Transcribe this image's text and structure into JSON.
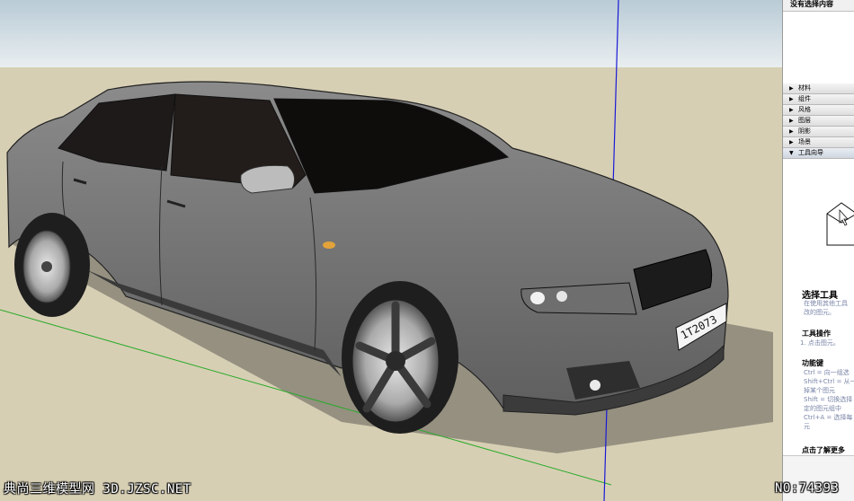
{
  "panel": {
    "title": "没有选择内容",
    "trays": [
      {
        "label": "材料",
        "state": "collapsed"
      },
      {
        "label": "组件",
        "state": "collapsed"
      },
      {
        "label": "风格",
        "state": "collapsed"
      },
      {
        "label": "图层",
        "state": "collapsed"
      },
      {
        "label": "阴影",
        "state": "collapsed"
      },
      {
        "label": "场景",
        "state": "collapsed"
      },
      {
        "label": "工具向导",
        "state": "expanded"
      }
    ]
  },
  "instructor": {
    "heading": "选择工具",
    "desc1": "在使用其他工具",
    "desc2": "改的图元。",
    "ops_title": "工具操作",
    "ops_line": "1.  点击图元。",
    "keys_title": "功能键",
    "keys_lines": [
      "Ctrl = 向一组选",
      "Shift+Ctrl = 从一",
      "掉某个图元",
      "Shift = 切换选择",
      "定的图元组中",
      "Ctrl+A = 选择每",
      "元"
    ],
    "more": "点击了解更多"
  },
  "watermark": {
    "left": "典尚三维模型网 3D.JZSC.NET",
    "right": "NO:74393"
  },
  "colors": {
    "sky": "#c9d7df",
    "ground": "#d7cfb4",
    "car_body": "#7b7b7b",
    "blue_axis": "#1a1ad6",
    "green_axis": "#2aaa2a"
  },
  "icons": {
    "tray_collapsed": "triangle-right",
    "tray_expanded": "triangle-down"
  }
}
